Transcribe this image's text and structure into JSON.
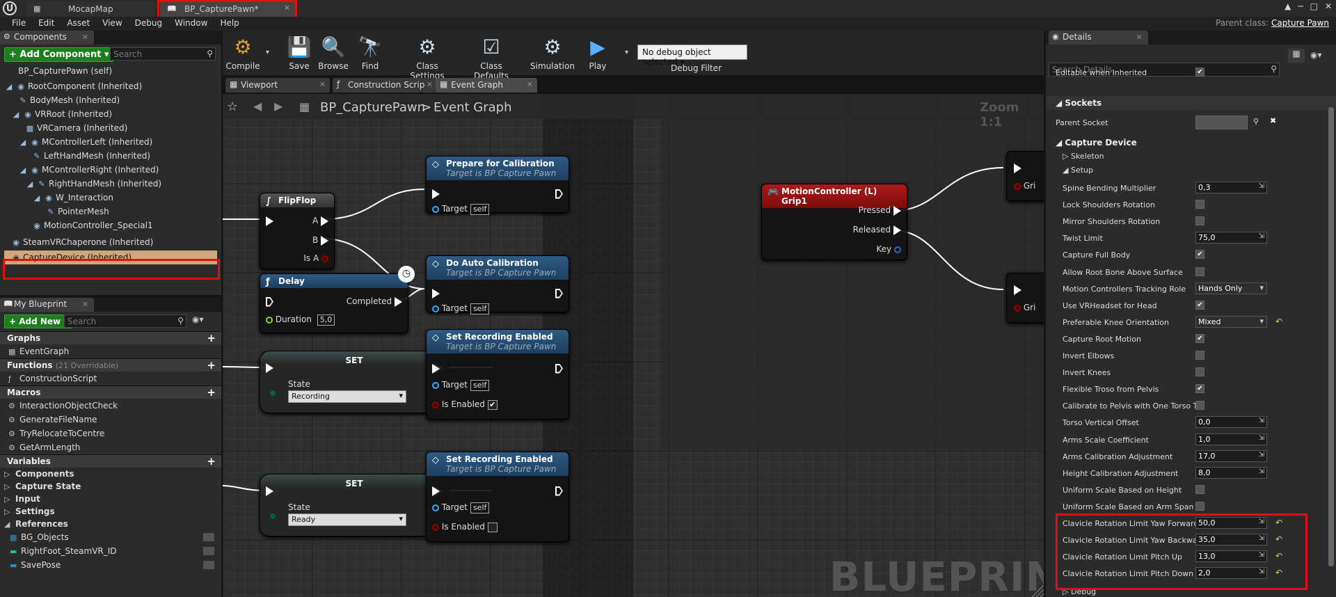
{
  "window": {
    "tabs": [
      {
        "label": "MocapMap",
        "icon": "map-icon"
      },
      {
        "label": "BP_CapturePawn*",
        "icon": "blueprint-icon"
      }
    ],
    "parent_class_label": "Parent class:",
    "parent_class_value": "Capture Pawn"
  },
  "menu": [
    "File",
    "Edit",
    "Asset",
    "View",
    "Debug",
    "Window",
    "Help"
  ],
  "components": {
    "tab_label": "Components",
    "add_button": "+ Add Component ▾",
    "search_placeholder": "Search",
    "self_item": "BP_CapturePawn (self)",
    "items": [
      "RootComponent (Inherited)",
      "BodyMesh (Inherited)",
      "VRRoot (Inherited)",
      "VRCamera (Inherited)",
      "MControllerLeft (Inherited)",
      "LeftHandMesh (Inherited)",
      "MControllerRight (Inherited)",
      "RightHandMesh (Inherited)",
      "W_Interaction",
      "PointerMesh",
      "MotionController_Special1",
      "SteamVRChaperone (Inherited)",
      "CaptureDevice (Inherited)"
    ]
  },
  "my_blueprint": {
    "tab_label": "My Blueprint",
    "add_button": "+ Add New ▾",
    "search_placeholder": "Search",
    "graphs_header": "Graphs",
    "graph_item": "EventGraph",
    "functions_header": "Functions",
    "functions_count": "(21 Overridable)",
    "function_item": "ConstructionScript",
    "macros_header": "Macros",
    "macros": [
      "InteractionObjectCheck",
      "GenerateFileName",
      "TryRelocateToCentre",
      "GetArmLength"
    ],
    "variables_header": "Variables",
    "variable_categories": [
      "Components",
      "Capture State",
      "Input",
      "Settings",
      "References"
    ],
    "variables": [
      "BG_Objects",
      "RightFoot_SteamVR_ID",
      "SavePose"
    ]
  },
  "toolbar": {
    "compile": "Compile",
    "save": "Save",
    "browse": "Browse",
    "find": "Find",
    "class_settings": "Class Settings",
    "class_defaults": "Class Defaults",
    "simulation": "Simulation",
    "play": "Play",
    "debug_object": "No debug object selected",
    "debug_filter": "Debug Filter"
  },
  "graph_tabs": [
    "Viewport",
    "Construction Scrip",
    "Event Graph"
  ],
  "graph": {
    "breadcrumb_root": "BP_CapturePawn",
    "breadcrumb_sep": ">",
    "breadcrumb_current": "Event Graph",
    "zoom": "Zoom 1:1",
    "watermark": "BLUEPRINT"
  },
  "nodes": {
    "flipflop": {
      "title": "FlipFlop",
      "a": "A",
      "b": "B",
      "isa": "Is A"
    },
    "delay": {
      "title": "Delay",
      "completed": "Completed",
      "duration_label": "Duration",
      "duration_value": "5,0"
    },
    "prepare": {
      "title": "Prepare for Calibration",
      "subtitle": "Target is BP Capture Pawn",
      "target": "Target",
      "self": "self"
    },
    "auto": {
      "title": "Do Auto Calibration",
      "subtitle": "Target is BP Capture Pawn",
      "target": "Target",
      "self": "self"
    },
    "set1": {
      "title": "SET",
      "state_label": "State",
      "state_value": "Recording"
    },
    "rec1": {
      "title": "Set Recording Enabled",
      "subtitle": "Target is BP Capture Pawn",
      "target": "Target",
      "self": "self",
      "enabled_label": "Is Enabled",
      "enabled_value": "✔"
    },
    "set2": {
      "title": "SET",
      "state_label": "State",
      "state_value": "Ready"
    },
    "rec2": {
      "title": "Set Recording Enabled",
      "subtitle": "Target is BP Capture Pawn",
      "target": "Target",
      "self": "self",
      "enabled_label": "Is Enabled",
      "enabled_value": ""
    },
    "motion": {
      "title": "MotionController (L) Grip1",
      "pressed": "Pressed",
      "released": "Released",
      "key": "Key"
    },
    "offscreen": {
      "label1": "Gri",
      "label2": "Gri"
    }
  },
  "details": {
    "tab_label": "Details",
    "search_placeholder": "Search Details",
    "editable_label": "Editable when Inherited",
    "sockets_header": "Sockets",
    "parent_socket_label": "Parent Socket",
    "capture_header": "Capture Device",
    "skeleton_label": "Skeleton",
    "setup_label": "Setup",
    "debug_label": "Debug",
    "rows": [
      {
        "label": "Spine Bending Multiplier",
        "kind": "num",
        "value": "0,3"
      },
      {
        "label": "Lock Shoulders Rotation",
        "kind": "chk",
        "value": ""
      },
      {
        "label": "Mirror Shoulders Rotation",
        "kind": "chk",
        "value": ""
      },
      {
        "label": "Twist Limit",
        "kind": "num",
        "value": "75,0"
      },
      {
        "label": "Capture Full Body",
        "kind": "chk",
        "value": "✔"
      },
      {
        "label": "Allow Root Bone Above Surface",
        "kind": "chk",
        "value": ""
      },
      {
        "label": "Motion Controllers Tracking Role",
        "kind": "sel",
        "value": "Hands Only"
      },
      {
        "label": "Use VRHeadset for Head",
        "kind": "chk",
        "value": "✔"
      },
      {
        "label": "Preferable Knee Orientation",
        "kind": "sel",
        "value": "Mixed",
        "reset": true
      },
      {
        "label": "Capture Root Motion",
        "kind": "chk",
        "value": "✔"
      },
      {
        "label": "Invert Elbows",
        "kind": "chk",
        "value": ""
      },
      {
        "label": "Invert Knees",
        "kind": "chk",
        "value": ""
      },
      {
        "label": "Flexible Troso from Pelvis",
        "kind": "chk",
        "value": "✔"
      },
      {
        "label": "Calibrate to Pelvis with One Torso Tr",
        "kind": "chk",
        "value": ""
      },
      {
        "label": "Torso Vertical Offset",
        "kind": "num",
        "value": "0,0"
      },
      {
        "label": "Arms Scale Coefficient",
        "kind": "num",
        "value": "1,0"
      },
      {
        "label": "Arms Calibration Adjustment",
        "kind": "num",
        "value": "17,0"
      },
      {
        "label": "Height Calibration Adjustment",
        "kind": "num",
        "value": "8,0"
      },
      {
        "label": "Uniform Scale Based on Height",
        "kind": "chk",
        "value": ""
      },
      {
        "label": "Uniform Scale Based on Arm Span",
        "kind": "chk",
        "value": ""
      },
      {
        "label": "Clavicle Rotation Limit Yaw Forward",
        "kind": "num",
        "value": "50,0",
        "reset": true
      },
      {
        "label": "Clavicle Rotation Limit Yaw Backward",
        "kind": "num",
        "value": "35,0",
        "reset": true
      },
      {
        "label": "Clavicle Rotation Limit Pitch Up",
        "kind": "num",
        "value": "13,0",
        "reset": true
      },
      {
        "label": "Clavicle Rotation Limit Pitch Down",
        "kind": "num",
        "value": "2,0",
        "reset": true
      }
    ]
  }
}
